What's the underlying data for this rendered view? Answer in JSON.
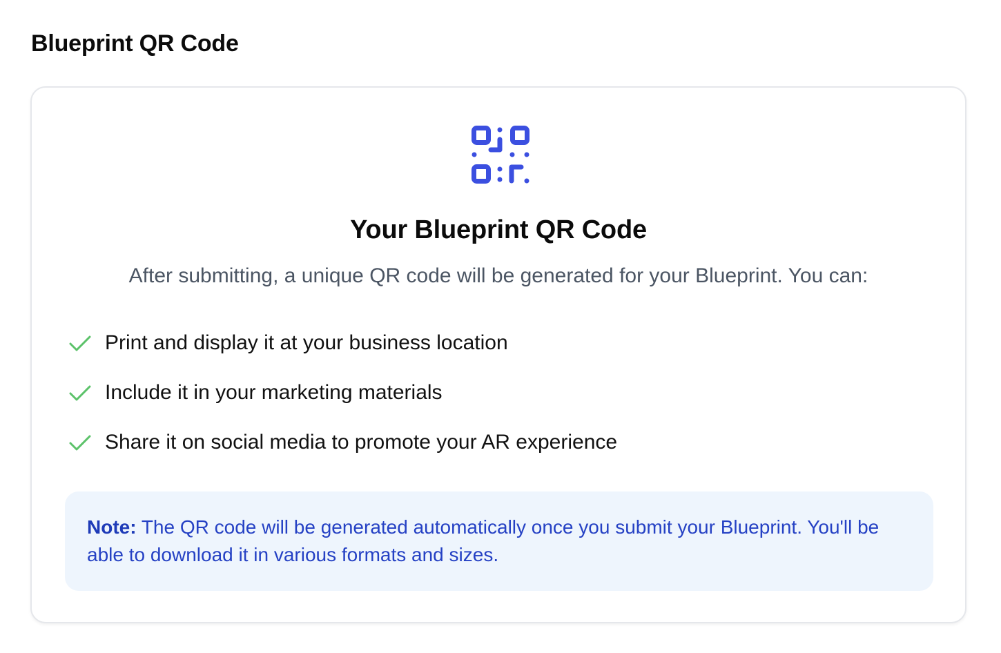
{
  "section": {
    "title": "Blueprint QR Code"
  },
  "card": {
    "icon": "qr-code-icon",
    "title": "Your Blueprint QR Code",
    "description": "After submitting, a unique QR code will be generated for your Blueprint. You can:",
    "benefits": [
      {
        "icon": "check-icon",
        "label": "Print and display it at your business location"
      },
      {
        "icon": "check-icon",
        "label": "Include it in your marketing materials"
      },
      {
        "icon": "check-icon",
        "label": "Share it on social media to promote your AR experience"
      }
    ],
    "note": {
      "label": "Note:",
      "text": " The QR code will be generated automatically once you submit your Blueprint. You'll be able to download it in various formats and sizes."
    }
  },
  "colors": {
    "accent": "#3b4fe0",
    "check": "#5cc26a",
    "note_background": "#eef5fd",
    "note_text": "#2541c4"
  }
}
